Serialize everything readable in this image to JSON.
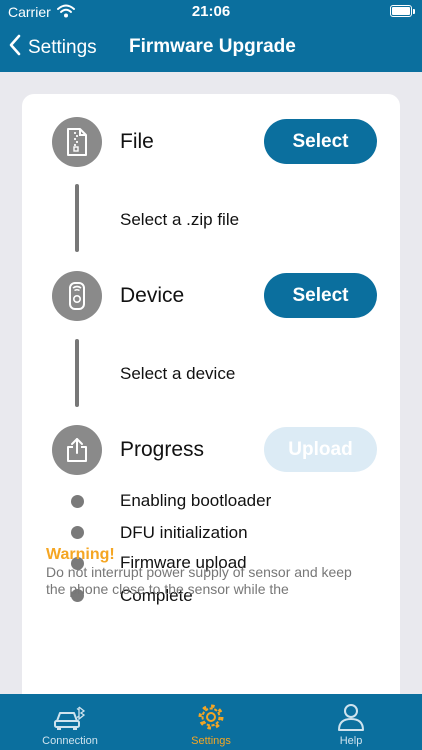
{
  "status_bar": {
    "carrier": "Carrier",
    "time": "21:06"
  },
  "nav": {
    "back_label": "Settings",
    "title": "Firmware Upgrade"
  },
  "steps": {
    "file": {
      "title": "File",
      "button": "Select",
      "hint": "Select a .zip file"
    },
    "device": {
      "title": "Device",
      "button": "Select",
      "hint": "Select a device"
    },
    "progress": {
      "title": "Progress",
      "button": "Upload",
      "button_enabled": false
    }
  },
  "stages": [
    "Enabling bootloader",
    "DFU initialization",
    "Firmware upload",
    "Complete"
  ],
  "warning": {
    "title": "Warning!",
    "text": "Do not interrupt power supply of sensor and keep the phone close to the sensor while the"
  },
  "tabs": [
    {
      "label": "Connection",
      "icon": "car-bluetooth-icon"
    },
    {
      "label": "Settings",
      "icon": "gear-icon",
      "active": true
    },
    {
      "label": "Help",
      "icon": "person-icon"
    }
  ],
  "colors": {
    "brand": "#0b6f9e",
    "accent": "#f5a623",
    "disabled_button": "#dcebf5",
    "step_icon_bg": "#8a8a8a"
  }
}
